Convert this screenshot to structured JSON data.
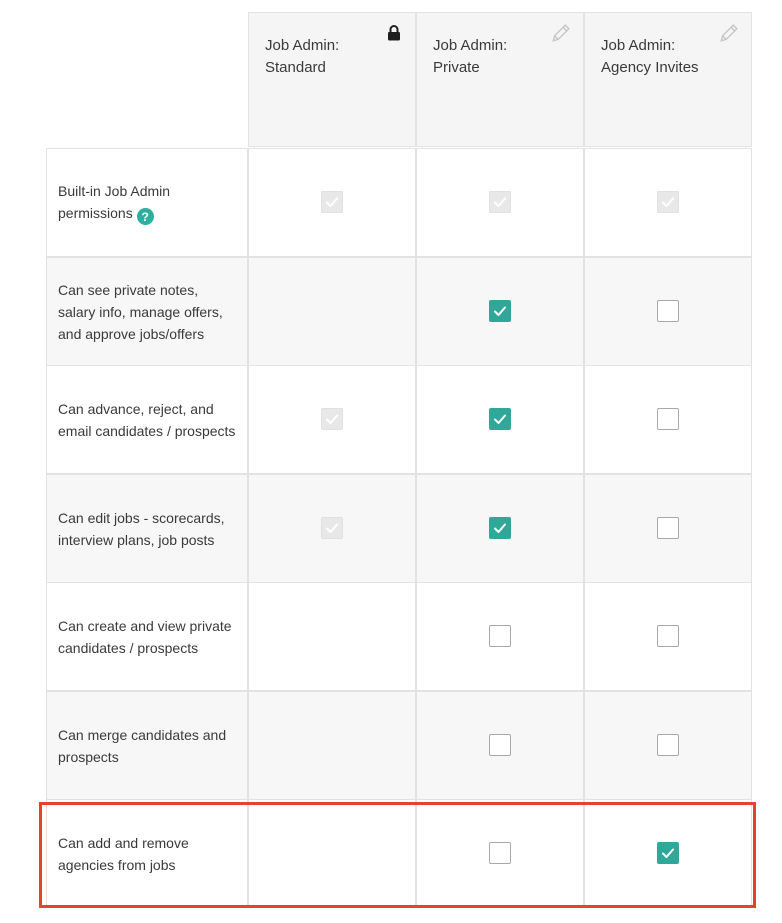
{
  "columns": [
    {
      "title_line1": "Job Admin:",
      "title_line2": "Standard",
      "icon": "lock-icon"
    },
    {
      "title_line1": "Job Admin:",
      "title_line2": "Private",
      "icon": "pencil-icon"
    },
    {
      "title_line1": "Job Admin:",
      "title_line2": "Agency Invites",
      "icon": "pencil-icon"
    }
  ],
  "rows": [
    {
      "label": "Built-in Job Admin permissions",
      "help_icon": true,
      "help_glyph": "?",
      "states": [
        "disabled",
        "disabled",
        "disabled"
      ]
    },
    {
      "label": "Can see private notes, salary info, manage offers, and approve jobs/offers",
      "states": [
        "none",
        "checked",
        "unchecked"
      ]
    },
    {
      "label": "Can advance, reject, and email candidates / prospects",
      "states": [
        "disabled",
        "checked",
        "unchecked"
      ]
    },
    {
      "label": "Can edit jobs - scorecards, interview plans, job posts",
      "states": [
        "disabled",
        "checked",
        "unchecked"
      ]
    },
    {
      "label": "Can create and view private candidates / prospects",
      "states": [
        "none",
        "unchecked",
        "unchecked"
      ]
    },
    {
      "label": "Can merge candidates and prospects",
      "states": [
        "none",
        "unchecked",
        "unchecked"
      ]
    },
    {
      "label": "Can add and remove agencies from jobs",
      "states": [
        "none",
        "unchecked",
        "checked"
      ],
      "highlighted": true
    }
  ],
  "colors": {
    "accent": "#2fa89a",
    "highlight": "#e4432e",
    "help": "#2bb0a0"
  }
}
